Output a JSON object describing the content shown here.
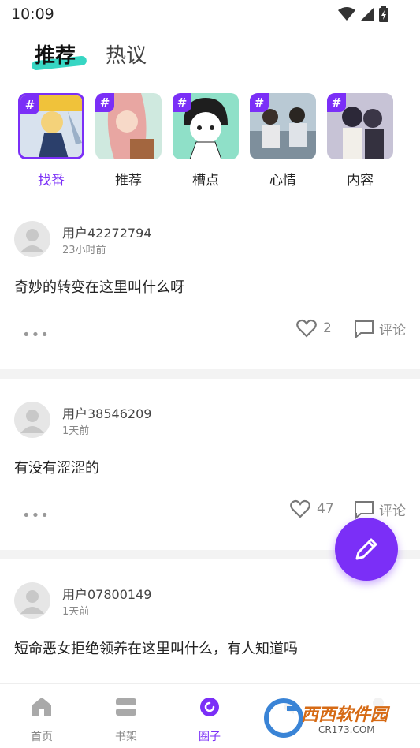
{
  "status": {
    "time": "10:09"
  },
  "tabs": [
    {
      "label": "推荐",
      "active": true
    },
    {
      "label": "热议",
      "active": false
    }
  ],
  "topics": [
    {
      "label": "找番",
      "selected": true,
      "hash": "#"
    },
    {
      "label": "推荐",
      "selected": false,
      "hash": "#"
    },
    {
      "label": "槽点",
      "selected": false,
      "hash": "#"
    },
    {
      "label": "心情",
      "selected": false,
      "hash": "#"
    },
    {
      "label": "内容",
      "selected": false,
      "hash": "#"
    }
  ],
  "posts": [
    {
      "username": "用户42272794",
      "time": "23小时前",
      "content": "奇妙的转变在这里叫什么呀",
      "likes": "2",
      "comment_label": "评论",
      "more": "•••"
    },
    {
      "username": "用户38546209",
      "time": "1天前",
      "content": "有没有涩涩的",
      "likes": "47",
      "comment_label": "评论",
      "more": "•••"
    },
    {
      "username": "用户07800149",
      "time": "1天前",
      "content": "短命恶女拒绝领养在这里叫什么，有人知道吗"
    }
  ],
  "nav": [
    {
      "label": "首页",
      "icon": "home-icon",
      "active": false
    },
    {
      "label": "书架",
      "icon": "bookshelf-icon",
      "active": false
    },
    {
      "label": "圈子",
      "icon": "circle-icon",
      "active": true
    }
  ],
  "watermark": {
    "text": "西西软件园",
    "sub": "CR173.COM"
  },
  "colors": {
    "accent": "#7b2ff7",
    "underline": "#37d6c3"
  }
}
